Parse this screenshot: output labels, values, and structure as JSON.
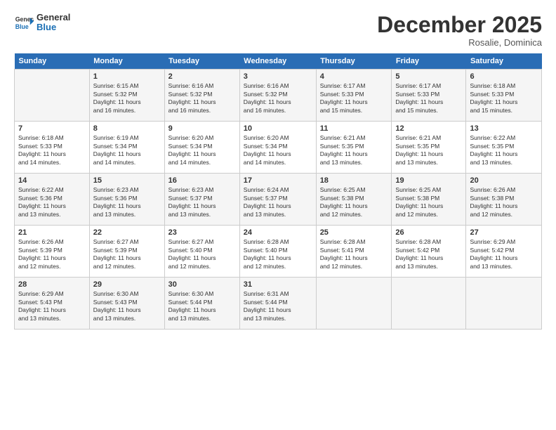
{
  "logo": {
    "line1": "General",
    "line2": "Blue"
  },
  "title": "December 2025",
  "location": "Rosalie, Dominica",
  "days_header": [
    "Sunday",
    "Monday",
    "Tuesday",
    "Wednesday",
    "Thursday",
    "Friday",
    "Saturday"
  ],
  "weeks": [
    [
      {
        "num": "",
        "info": ""
      },
      {
        "num": "1",
        "info": "Sunrise: 6:15 AM\nSunset: 5:32 PM\nDaylight: 11 hours\nand 16 minutes."
      },
      {
        "num": "2",
        "info": "Sunrise: 6:16 AM\nSunset: 5:32 PM\nDaylight: 11 hours\nand 16 minutes."
      },
      {
        "num": "3",
        "info": "Sunrise: 6:16 AM\nSunset: 5:32 PM\nDaylight: 11 hours\nand 16 minutes."
      },
      {
        "num": "4",
        "info": "Sunrise: 6:17 AM\nSunset: 5:33 PM\nDaylight: 11 hours\nand 15 minutes."
      },
      {
        "num": "5",
        "info": "Sunrise: 6:17 AM\nSunset: 5:33 PM\nDaylight: 11 hours\nand 15 minutes."
      },
      {
        "num": "6",
        "info": "Sunrise: 6:18 AM\nSunset: 5:33 PM\nDaylight: 11 hours\nand 15 minutes."
      }
    ],
    [
      {
        "num": "7",
        "info": "Sunrise: 6:18 AM\nSunset: 5:33 PM\nDaylight: 11 hours\nand 14 minutes."
      },
      {
        "num": "8",
        "info": "Sunrise: 6:19 AM\nSunset: 5:34 PM\nDaylight: 11 hours\nand 14 minutes."
      },
      {
        "num": "9",
        "info": "Sunrise: 6:20 AM\nSunset: 5:34 PM\nDaylight: 11 hours\nand 14 minutes."
      },
      {
        "num": "10",
        "info": "Sunrise: 6:20 AM\nSunset: 5:34 PM\nDaylight: 11 hours\nand 14 minutes."
      },
      {
        "num": "11",
        "info": "Sunrise: 6:21 AM\nSunset: 5:35 PM\nDaylight: 11 hours\nand 13 minutes."
      },
      {
        "num": "12",
        "info": "Sunrise: 6:21 AM\nSunset: 5:35 PM\nDaylight: 11 hours\nand 13 minutes."
      },
      {
        "num": "13",
        "info": "Sunrise: 6:22 AM\nSunset: 5:35 PM\nDaylight: 11 hours\nand 13 minutes."
      }
    ],
    [
      {
        "num": "14",
        "info": "Sunrise: 6:22 AM\nSunset: 5:36 PM\nDaylight: 11 hours\nand 13 minutes."
      },
      {
        "num": "15",
        "info": "Sunrise: 6:23 AM\nSunset: 5:36 PM\nDaylight: 11 hours\nand 13 minutes."
      },
      {
        "num": "16",
        "info": "Sunrise: 6:23 AM\nSunset: 5:37 PM\nDaylight: 11 hours\nand 13 minutes."
      },
      {
        "num": "17",
        "info": "Sunrise: 6:24 AM\nSunset: 5:37 PM\nDaylight: 11 hours\nand 13 minutes."
      },
      {
        "num": "18",
        "info": "Sunrise: 6:25 AM\nSunset: 5:38 PM\nDaylight: 11 hours\nand 12 minutes."
      },
      {
        "num": "19",
        "info": "Sunrise: 6:25 AM\nSunset: 5:38 PM\nDaylight: 11 hours\nand 12 minutes."
      },
      {
        "num": "20",
        "info": "Sunrise: 6:26 AM\nSunset: 5:38 PM\nDaylight: 11 hours\nand 12 minutes."
      }
    ],
    [
      {
        "num": "21",
        "info": "Sunrise: 6:26 AM\nSunset: 5:39 PM\nDaylight: 11 hours\nand 12 minutes."
      },
      {
        "num": "22",
        "info": "Sunrise: 6:27 AM\nSunset: 5:39 PM\nDaylight: 11 hours\nand 12 minutes."
      },
      {
        "num": "23",
        "info": "Sunrise: 6:27 AM\nSunset: 5:40 PM\nDaylight: 11 hours\nand 12 minutes."
      },
      {
        "num": "24",
        "info": "Sunrise: 6:28 AM\nSunset: 5:40 PM\nDaylight: 11 hours\nand 12 minutes."
      },
      {
        "num": "25",
        "info": "Sunrise: 6:28 AM\nSunset: 5:41 PM\nDaylight: 11 hours\nand 12 minutes."
      },
      {
        "num": "26",
        "info": "Sunrise: 6:28 AM\nSunset: 5:42 PM\nDaylight: 11 hours\nand 13 minutes."
      },
      {
        "num": "27",
        "info": "Sunrise: 6:29 AM\nSunset: 5:42 PM\nDaylight: 11 hours\nand 13 minutes."
      }
    ],
    [
      {
        "num": "28",
        "info": "Sunrise: 6:29 AM\nSunset: 5:43 PM\nDaylight: 11 hours\nand 13 minutes."
      },
      {
        "num": "29",
        "info": "Sunrise: 6:30 AM\nSunset: 5:43 PM\nDaylight: 11 hours\nand 13 minutes."
      },
      {
        "num": "30",
        "info": "Sunrise: 6:30 AM\nSunset: 5:44 PM\nDaylight: 11 hours\nand 13 minutes."
      },
      {
        "num": "31",
        "info": "Sunrise: 6:31 AM\nSunset: 5:44 PM\nDaylight: 11 hours\nand 13 minutes."
      },
      {
        "num": "",
        "info": ""
      },
      {
        "num": "",
        "info": ""
      },
      {
        "num": "",
        "info": ""
      }
    ]
  ]
}
